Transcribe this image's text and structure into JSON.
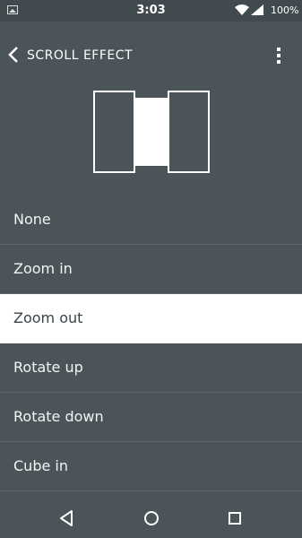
{
  "status_bar": {
    "time": "3:03",
    "battery": "100%",
    "icons": [
      "image-icon",
      "wifi-icon",
      "signal-icon"
    ]
  },
  "toolbar": {
    "title": "SCROLL EFFECT",
    "back_icon": "chevron-left-icon",
    "menu_icon": "more-vertical-icon"
  },
  "effects": [
    {
      "label": "None"
    },
    {
      "label": "Zoom in"
    },
    {
      "label": "Zoom out",
      "selected": true
    },
    {
      "label": "Rotate up"
    },
    {
      "label": "Rotate down"
    },
    {
      "label": "Cube in"
    }
  ],
  "navbar": {
    "icons": [
      "back-triangle-icon",
      "home-circle-icon",
      "recents-square-icon"
    ]
  },
  "colors": {
    "background": "#4b5458",
    "status_bar": "#414a4e",
    "selected_bg": "#ffffff",
    "selected_text": "#3a4347",
    "divider": "#5e666a"
  }
}
